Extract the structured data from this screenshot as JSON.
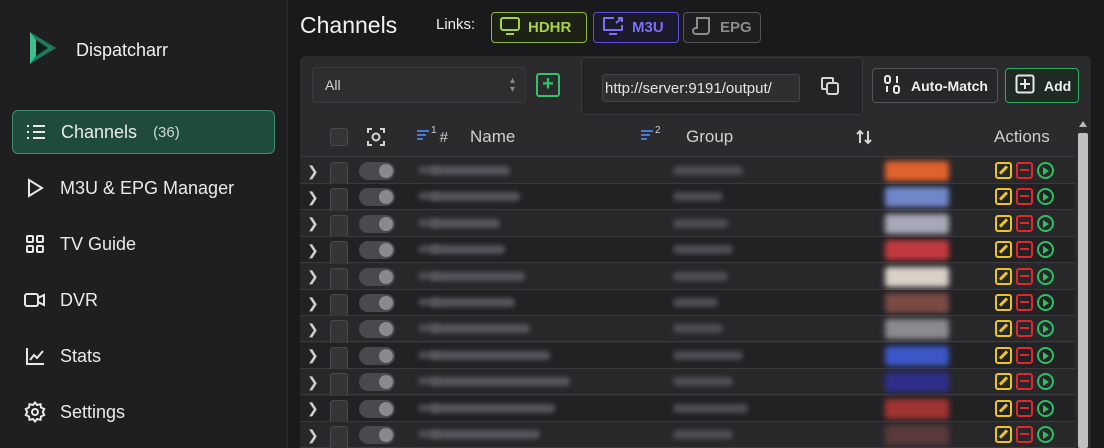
{
  "app": {
    "name": "Dispatcharr"
  },
  "sidebar": {
    "items": [
      {
        "label": "Channels",
        "count": "(36)",
        "icon": "list-icon",
        "active": true
      },
      {
        "label": "M3U & EPG Manager",
        "icon": "play-icon"
      },
      {
        "label": "TV Guide",
        "icon": "grid-icon"
      },
      {
        "label": "DVR",
        "icon": "video-icon"
      },
      {
        "label": "Stats",
        "icon": "chart-icon"
      },
      {
        "label": "Settings",
        "icon": "gear-icon"
      }
    ]
  },
  "header": {
    "title": "Channels",
    "links_label": "Links:",
    "links": [
      {
        "label": "HDHR",
        "icon": "monitor-icon",
        "color": "#a5d14b"
      },
      {
        "label": "M3U",
        "icon": "screen-share-icon",
        "color": "#7a6ff5"
      },
      {
        "label": "EPG",
        "icon": "scroll-icon",
        "color": "#8c8c8c"
      }
    ]
  },
  "toolbar": {
    "filter_value": "All",
    "url_value": "http://server:9191/output/",
    "auto_match_label": "Auto-Match",
    "add_label": "Add"
  },
  "table": {
    "columns": {
      "sort1": "1",
      "number": "#",
      "name": "Name",
      "sort2": "2",
      "group": "Group",
      "actions": "Actions"
    },
    "rows": [
      {
        "name_w": 80,
        "group_w": 70,
        "logo": "#e0622c"
      },
      {
        "name_w": 90,
        "group_w": 50,
        "logo": "#6f86c9"
      },
      {
        "name_w": 70,
        "group_w": 55,
        "logo": "#a8a8b8"
      },
      {
        "name_w": 75,
        "group_w": 60,
        "logo": "#c0393f"
      },
      {
        "name_w": 95,
        "group_w": 55,
        "logo": "#d9d0c8"
      },
      {
        "name_w": 85,
        "group_w": 45,
        "logo": "#7a4a44"
      },
      {
        "name_w": 100,
        "group_w": 50,
        "logo": "#8a8a90"
      },
      {
        "name_w": 120,
        "group_w": 70,
        "logo": "#3c57c7"
      },
      {
        "name_w": 140,
        "group_w": 60,
        "logo": "#2f2f8a"
      },
      {
        "name_w": 125,
        "group_w": 75,
        "logo": "#a23333"
      },
      {
        "name_w": 110,
        "group_w": 60,
        "logo": "#5a3a3a"
      }
    ]
  }
}
